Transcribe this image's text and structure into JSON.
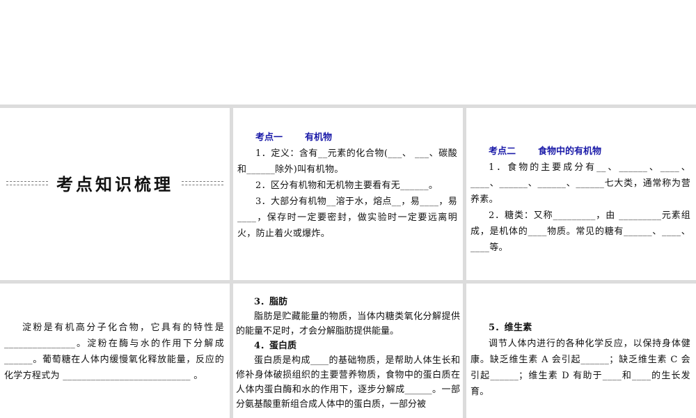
{
  "cover": {
    "title": "考点知识梳理"
  },
  "section1": {
    "heading_num": "考点一",
    "heading_title": "有机物",
    "paragraphs": [
      "1．定义：含有__元素的化合物(___、 ___、碳酸和______除外)叫有机物。",
      "2．区分有机物和无机物主要看有无______。",
      "3．大部分有机物__溶于水，熔点__，易____，易____，保存时一定要密封，做实验时一定要远离明火，防止着火或爆炸。"
    ]
  },
  "section2": {
    "heading_num": "考点二",
    "heading_title": "食物中的有机物",
    "paragraphs": [
      "1．食物的主要成分有__、______、____、____、______、______、______七大类，通常称为营养素。",
      "2．糖类：又称_________，由 _________元素组成，是机体的____物质。常见的糖有______、____、____等。"
    ]
  },
  "starch": {
    "paragraph": "淀粉是有机高分子化合物，它具有的特性是_______________。淀粉在酶与水的作用下分解成______。葡萄糖在人体内缓慢氧化释放能量，反应的化学方程式为 ___________________________ 。"
  },
  "fat_protein": {
    "fat_heading": "3．脂肪",
    "fat_text": "脂肪是贮藏能量的物质，当体内糖类氧化分解提供的能量不足时，才会分解脂肪提供能量。",
    "protein_heading": "4．蛋白质",
    "protein_text": "蛋白质是构成____的基础物质，是帮助人体生长和修补身体破损组织的主要营养物质，食物中的蛋白质在人体内蛋白酶和水的作用下，逐步分解成______。一部分氨基酸重新组合成人体中的蛋白质，一部分被"
  },
  "vitamin": {
    "heading": "5．维生素",
    "text": "调节人体内进行的各种化学反应，以保持身体健康。缺乏维生素 A 会引起______；缺乏维生素 C 会引起______；维生素 D 有助于____和____的生长发育。"
  }
}
